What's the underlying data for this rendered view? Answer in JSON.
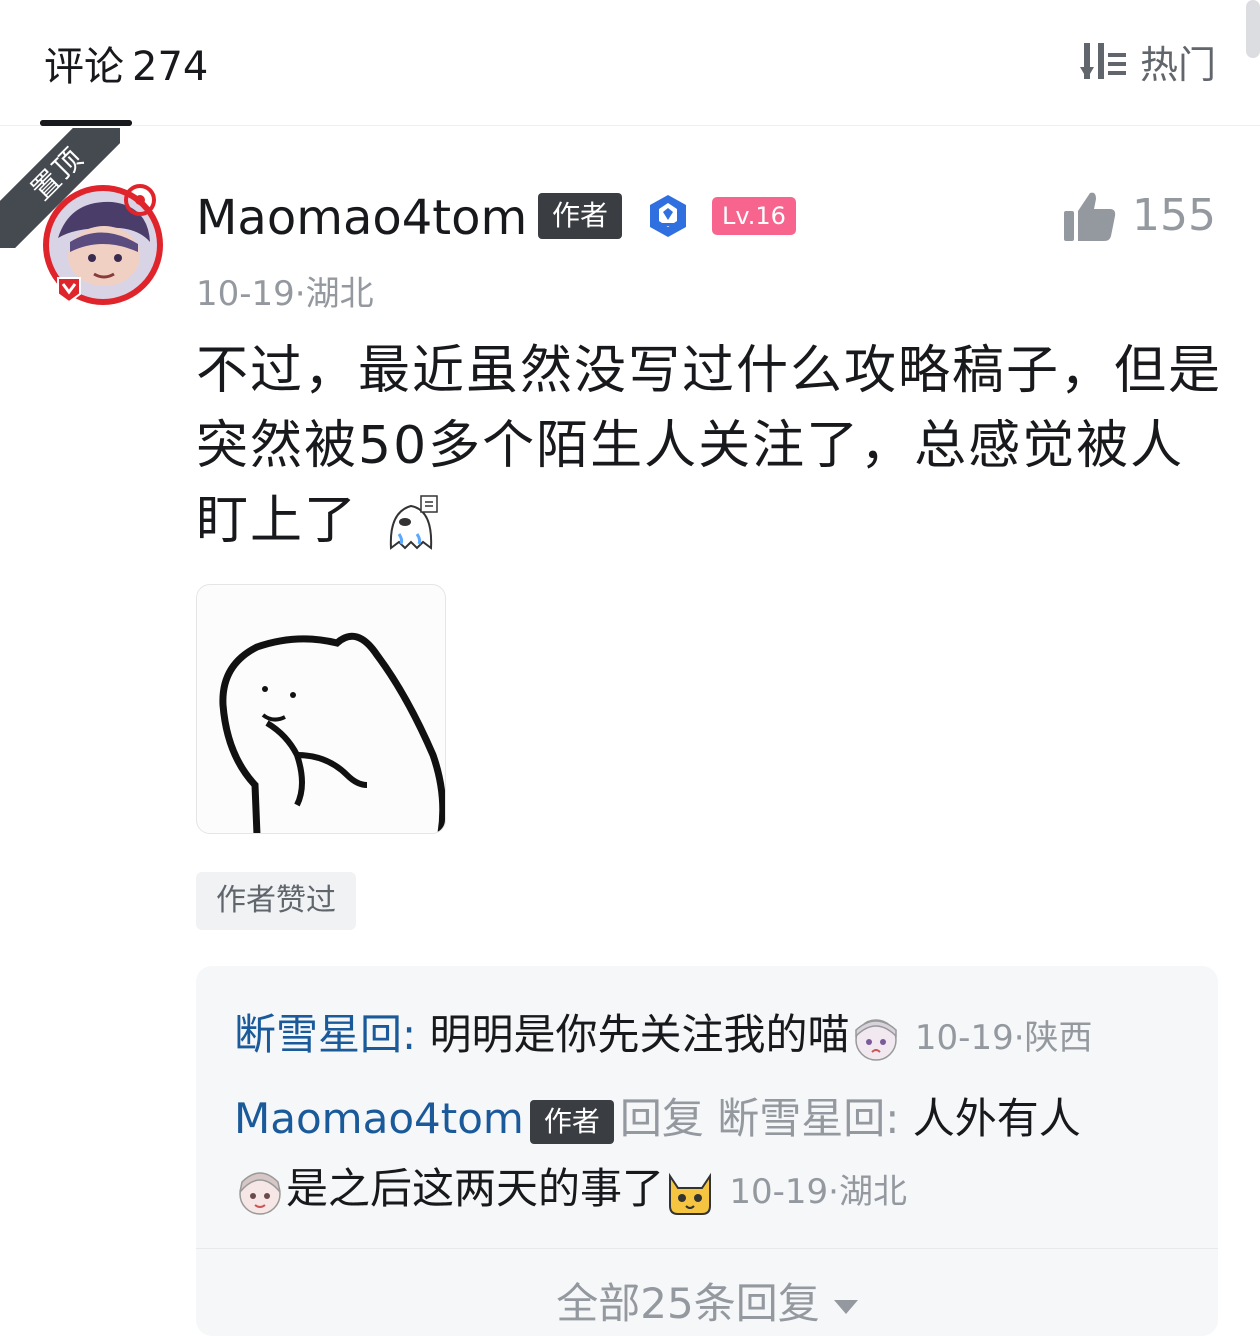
{
  "header": {
    "title": "评论",
    "count": "274",
    "sort_label": "热门"
  },
  "comment": {
    "pin_label": "置顶",
    "username": "Maomao4tom",
    "author_tag": "作者",
    "level": "Lv.16",
    "likes": "155",
    "date": "10-19",
    "location": "湖北",
    "text": "不过，最近虽然没写过什么攻略稿子，但是突然被50多个陌生人关注了，总感觉被人盯上了",
    "liked_by_author": "作者赞过"
  },
  "replies": [
    {
      "name": "断雪星回",
      "text": "明明是你先关注我的喵",
      "date": "10-19",
      "location": "陕西"
    },
    {
      "name": "Maomao4tom",
      "tag": "作者",
      "reply_word": "回复",
      "reply_to": "断雪星回",
      "text_part1": "人外有人",
      "text_part2": "是之后这两天的事了",
      "date": "10-19",
      "location": "湖北"
    }
  ],
  "more_replies": {
    "label": "全部25条回复"
  },
  "colors": {
    "reply_name": "#1a5a9a",
    "level_tag": "#f7658e",
    "author_tag": "#3a3d42",
    "muted": "#9499a0"
  },
  "icons": [
    "sort-icon",
    "verified-icon",
    "like-icon",
    "caret-down-icon"
  ]
}
